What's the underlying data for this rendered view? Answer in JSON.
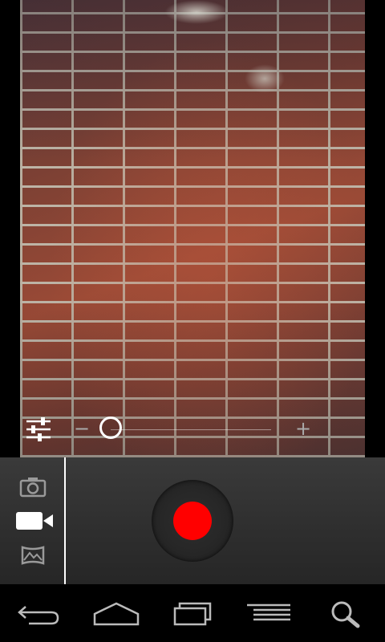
{
  "app": {
    "mode": "video"
  },
  "colors": {
    "record": "#ff0000",
    "divider": "#ffffff",
    "control_bg": "#2e2e2e"
  },
  "zoom": {
    "minus_label": "−",
    "plus_label": "+",
    "level_fraction": 0.0
  },
  "modes": [
    {
      "name": "camera-icon",
      "active": false
    },
    {
      "name": "video-camera-icon",
      "active": true
    },
    {
      "name": "panorama-icon",
      "active": false
    }
  ],
  "nav": [
    {
      "name": "back-icon"
    },
    {
      "name": "home-icon"
    },
    {
      "name": "recent-apps-icon"
    },
    {
      "name": "menu-icon"
    },
    {
      "name": "search-icon"
    }
  ]
}
